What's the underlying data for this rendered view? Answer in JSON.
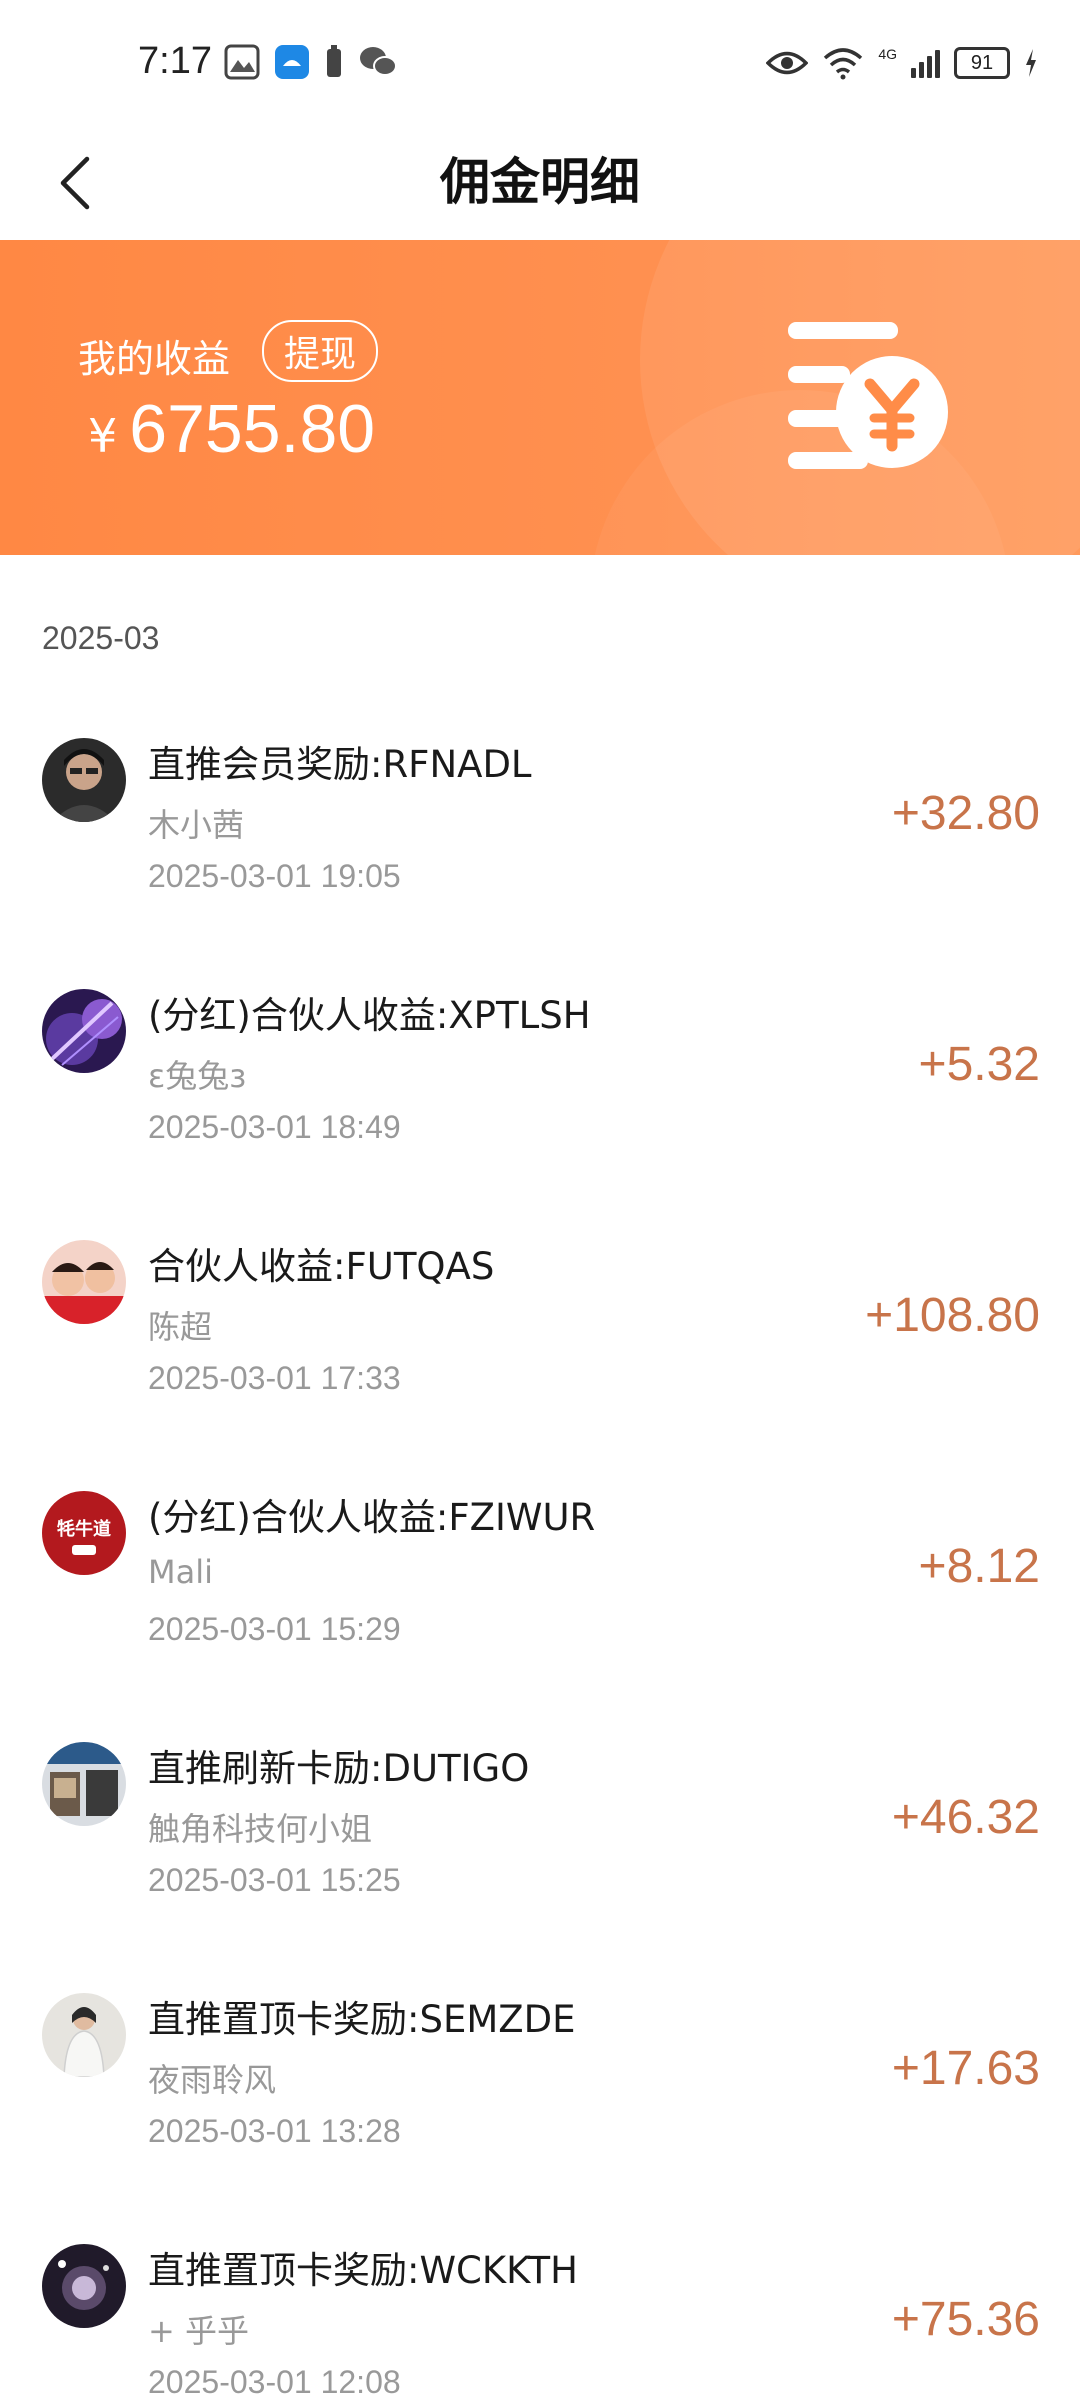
{
  "status_bar": {
    "time": "7:17",
    "network": "4G",
    "battery": "91"
  },
  "nav": {
    "title": "佣金明细"
  },
  "banner": {
    "earnings_label": "我的收益",
    "withdraw_label": "提现",
    "currency": "¥",
    "amount": "6755.80"
  },
  "month_header": "2025-03",
  "records": [
    {
      "title": "直推会员奖励:RFNADL",
      "user": "木小茜",
      "time": "2025-03-01 19:05",
      "amount": "+32.80"
    },
    {
      "title": "(分红)合伙人收益:XPTLSH",
      "user": "ε兔兔з",
      "time": "2025-03-01 18:49",
      "amount": "+5.32"
    },
    {
      "title": "合伙人收益:FUTQAS",
      "user": "陈超",
      "time": "2025-03-01 17:33",
      "amount": "+108.80"
    },
    {
      "title": "(分红)合伙人收益:FZIWUR",
      "user": "Mali",
      "time": "2025-03-01 15:29",
      "amount": "+8.12"
    },
    {
      "title": "直推刷新卡励:DUTIGO",
      "user": "触角科技何小姐",
      "time": "2025-03-01 15:25",
      "amount": "+46.32"
    },
    {
      "title": "直推置顶卡奖励:SEMZDE",
      "user": "夜雨聆风",
      "time": "2025-03-01 13:28",
      "amount": "+17.63"
    },
    {
      "title": "直推置顶卡奖励:WCKKTH",
      "user": "+ 乎乎",
      "time": "2025-03-01 12:08",
      "amount": "+75.36"
    }
  ],
  "avatar_badge_text": "牦牛道",
  "colors": {
    "banner": "#ff8844",
    "amount_text": "#c8744a"
  }
}
